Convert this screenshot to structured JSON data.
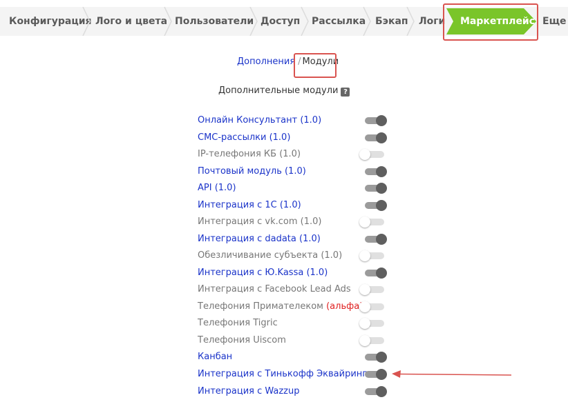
{
  "tabs": [
    {
      "label": "Конфигурация"
    },
    {
      "label": "Лого и цвета"
    },
    {
      "label": "Пользователи"
    },
    {
      "label": "Доступ"
    },
    {
      "label": "Рассылка"
    },
    {
      "label": "Бэкап"
    },
    {
      "label": "Логи"
    },
    {
      "label": "Маркетплейс",
      "active": true
    },
    {
      "label": "Еще"
    }
  ],
  "subnav": {
    "addons": "Дополнения",
    "separator": "/",
    "modules": "Модули"
  },
  "section_title": "Дополнительные модули",
  "help_glyph": "?",
  "modules": [
    {
      "label": "Онлайн Консультант (1.0)",
      "enabled": true
    },
    {
      "label": "СМС-рассылки (1.0)",
      "enabled": true
    },
    {
      "label": "IP-телефония КБ (1.0)",
      "enabled": false
    },
    {
      "label": "Почтовый модуль (1.0)",
      "enabled": true
    },
    {
      "label": "API (1.0)",
      "enabled": true
    },
    {
      "label": "Интеграция с 1С (1.0)",
      "enabled": true
    },
    {
      "label": "Интеграция с vk.com (1.0)",
      "enabled": false
    },
    {
      "label": "Интеграция с dadata (1.0)",
      "enabled": true
    },
    {
      "label": "Обезличивание субъекта (1.0)",
      "enabled": false
    },
    {
      "label": "Интеграция с Ю.Kassa (1.0)",
      "enabled": true
    },
    {
      "label": "Интеграция с Facebook Lead Ads",
      "enabled": false
    },
    {
      "label": "Телефония Примателеком",
      "badge": "(альфа)",
      "enabled": false
    },
    {
      "label": "Телефония Tigric",
      "enabled": false
    },
    {
      "label": "Телефония Uiscom",
      "enabled": false
    },
    {
      "label": "Канбан",
      "enabled": true
    },
    {
      "label": "Интеграция с Тинькофф Эквайринг",
      "enabled": true
    },
    {
      "label": "Интеграция с Wazzup",
      "enabled": true
    }
  ],
  "colors": {
    "active_tab": "#7ac52a",
    "link": "#1a33c9",
    "highlight": "#d9534f",
    "alpha_badge": "#e02020"
  }
}
